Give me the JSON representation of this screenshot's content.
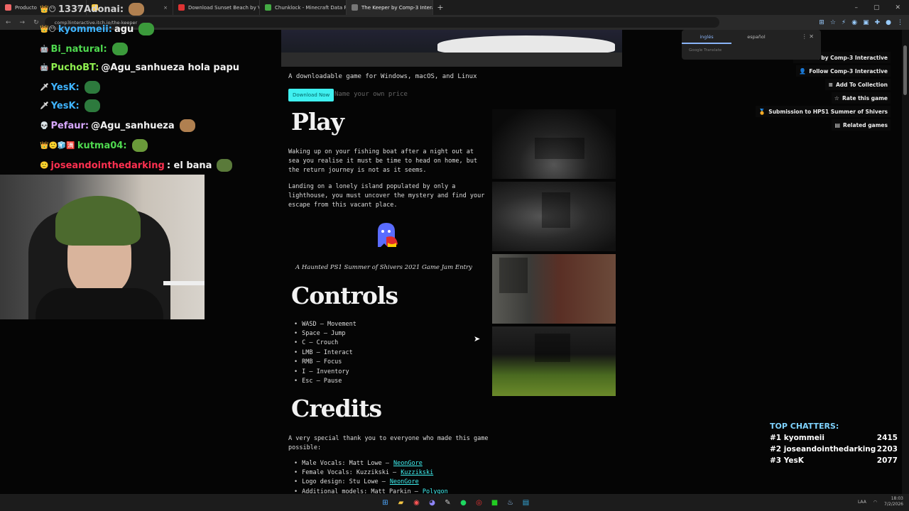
{
  "browser": {
    "tabs": [
      {
        "label": "Producto",
        "color": "#e66",
        "active": false
      },
      {
        "label": "",
        "color": "#fc4",
        "active": false
      },
      {
        "label": "Download Sunset Beach by Va",
        "color": "#d33",
        "active": false
      },
      {
        "label": "Chunklock - Minecraft Data Pa",
        "color": "#4a4",
        "active": false
      },
      {
        "label": "The Keeper by Comp-3 Interac",
        "color": "#777",
        "active": true
      }
    ],
    "url": "comp3interactive.itch.io/the-keeper",
    "new_tab": "+"
  },
  "translate_popup": {
    "lang_from": "inglés",
    "lang_to": "español",
    "footer": "Google Translate"
  },
  "game": {
    "subtitle": "A downloadable game for Windows, macOS, and Linux",
    "download_label": "Download Now",
    "price_label": "Name your own price",
    "play_heading": "Play",
    "play_p1": "Waking up on your fishing boat after a night out at sea you realise it must be time to head on home, but the return journey is not as it seems.",
    "play_p2": "Landing on a lonely island populated by only a lighthouse, you must uncover the mystery and find your escape from this vacant place.",
    "jam_entry": "A Haunted PS1 Summer of Shivers 2021 Game Jam Entry",
    "controls_heading": "Controls",
    "controls": [
      "WASD – Movement",
      "Space – Jump",
      "C – Crouch",
      "LMB – Interact",
      "RMB – Focus",
      "I – Inventory",
      "Esc – Pause"
    ],
    "credits_heading": "Credits",
    "credits_intro": "A very special thank you to everyone who made this game possible:",
    "credits": [
      {
        "role": "Male Vocals: Matt Lowe –",
        "link": "NeonGore"
      },
      {
        "role": "Female Vocals: Kuzzikski –",
        "link": "Kuzzikski"
      },
      {
        "role": "Logo design: Stu Lowe –",
        "link": "NeonGore"
      },
      {
        "role": "Additional models: Matt Parkin –",
        "link": "Polygon"
      }
    ]
  },
  "side_buttons": [
    {
      "icon": "",
      "label": "View all by Comp-3 Interactive"
    },
    {
      "icon": "👤",
      "label": "Follow Comp-3 Interactive"
    },
    {
      "icon": "≡",
      "label": "Add To Collection"
    },
    {
      "icon": "☆",
      "label": "Rate this game"
    },
    {
      "icon": "🏅",
      "label": "Submission to HPS1 Summer of Shivers"
    },
    {
      "icon": "▤",
      "label": "Related games"
    }
  ],
  "chat": [
    {
      "badges": "👑😶",
      "user": "1337Adonai:",
      "color": "#cfcfcf",
      "text": ""
    },
    {
      "badges": "👑😶",
      "user": "kyommeii:",
      "color": "#3fb4ff",
      "text": "agu"
    },
    {
      "badges": "🤖",
      "user": "Bi_natural:",
      "color": "#4fd94f",
      "text": ""
    },
    {
      "badges": "🤖",
      "user": "PuchoBT:",
      "color": "#8ff04f",
      "text": "@Agu_sanhueza hola papu"
    },
    {
      "badges": "🗡",
      "user": "YesK:",
      "color": "#3fb4ff",
      "text": ""
    },
    {
      "badges": "🗡",
      "user": "YesK:",
      "color": "#3fb4ff",
      "text": ""
    },
    {
      "badges": "💀",
      "user": "Pefaur:",
      "color": "#d8a8ff",
      "text": "@Agu_sanhueza"
    },
    {
      "badges": "👑🙂🧊🈵",
      "user": "kutma04:",
      "color": "#4fd94f",
      "text": ""
    },
    {
      "badges": "🙂",
      "user": "joseandointhedarking",
      "color": "#ff3050",
      "text": ": el bana"
    }
  ],
  "top_chatters": {
    "title": "TOP CHATTERS:",
    "rows": [
      {
        "rank": "#1",
        "name": "kyommeii",
        "count": "2415"
      },
      {
        "rank": "#2",
        "name": "joseandointhedarking",
        "count": "2203"
      },
      {
        "rank": "#3",
        "name": "YesK",
        "count": "2077"
      }
    ]
  },
  "taskbar": {
    "lang": "LAA",
    "time": "18:03",
    "date": "7/2/2026"
  }
}
